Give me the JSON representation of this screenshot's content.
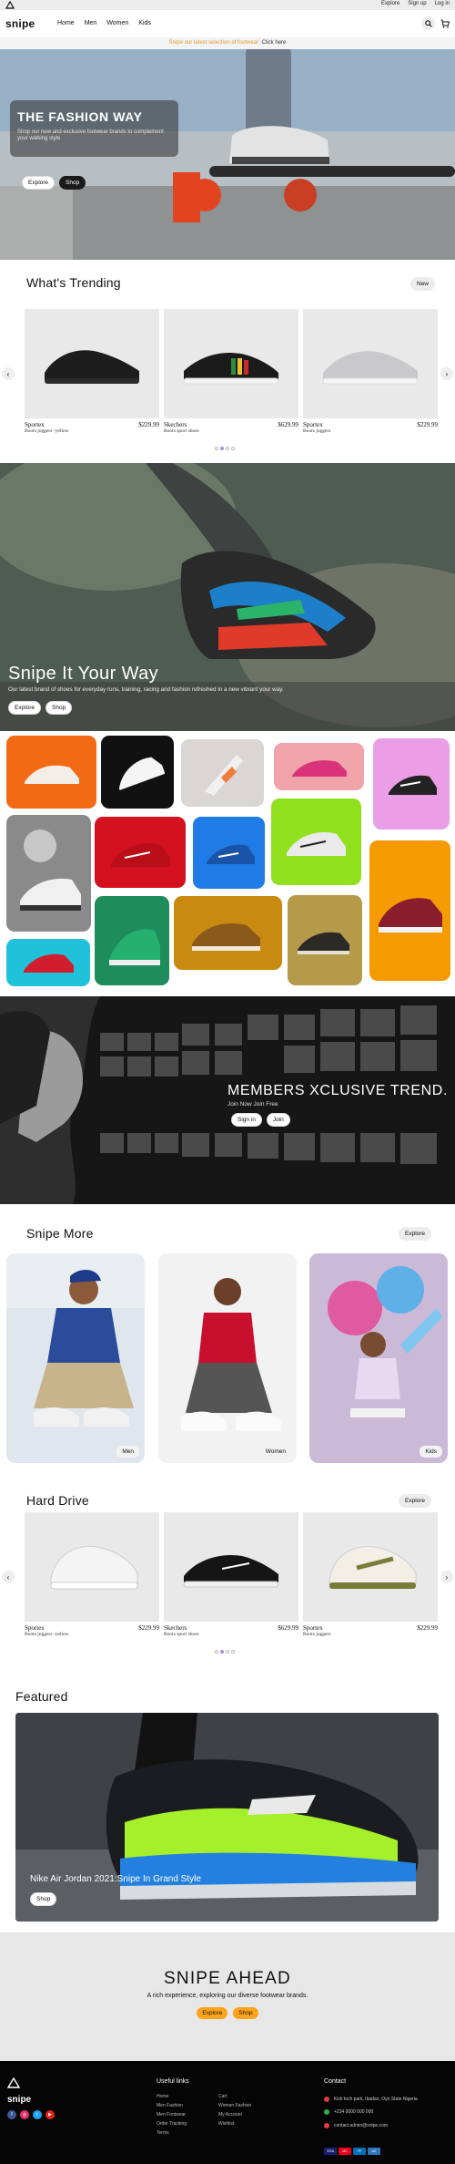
{
  "util": {
    "links": [
      "Explore",
      "Sign up",
      "Log in"
    ]
  },
  "nav": {
    "brand": "snipe",
    "menu": [
      "Home",
      "Men",
      "Women",
      "Kids"
    ]
  },
  "promo": {
    "text": "Snipe our latest selection of footwear",
    "link": "Click here"
  },
  "hero": {
    "title": "THE FASHION WAY",
    "subtitle": "Shop our new and exclusive footwear brands to complement your walking style",
    "buttons": [
      "Explore",
      "Shop"
    ]
  },
  "trending": {
    "title": "What's Trending",
    "pill": "New",
    "products": [
      {
        "name": "Sportex",
        "sub": "Boots joggers -yellow",
        "price": "$229.99"
      },
      {
        "name": "Skechers",
        "sub": "Boots sport shoes",
        "price": "$629.99"
      },
      {
        "name": "Sportex",
        "sub": "Boots joggers",
        "price": "$229.99"
      }
    ]
  },
  "snipe_it": {
    "title": "Snipe It Your Way",
    "subtitle": "Our latest brand of shoes for everyday runs, training, racing and fashion refreshed in a new vibrant your way.",
    "buttons": [
      "Explore",
      "Shop"
    ]
  },
  "members": {
    "title": "MEMBERS XCLUSIVE TREND.",
    "subtitle": "Join Now Join Free",
    "buttons": [
      "Sign in",
      "Join"
    ]
  },
  "snipe_more": {
    "title": "Snipe More",
    "pill": "Explore",
    "categories": [
      "Men",
      "Women",
      "Kids"
    ]
  },
  "hard_drive": {
    "title": "Hard Drive",
    "pill": "Explore",
    "products": [
      {
        "name": "Sportex",
        "sub": "Boots joggers -yellow",
        "price": "$229.99"
      },
      {
        "name": "Skechers",
        "sub": "Boots sport shoes",
        "price": "$629.99"
      },
      {
        "name": "Sportex",
        "sub": "Boots joggers",
        "price": "$229.99"
      }
    ]
  },
  "featured": {
    "title": "Featured",
    "caption": "Nike Air Jordan 2021:Snipe In Grand Style",
    "button": "Shop"
  },
  "ahead": {
    "title": "SNIPE AHEAD",
    "subtitle": "A rich experience, exploring our diverse footwear brands.",
    "buttons": [
      "Explore",
      "Shop"
    ]
  },
  "footer": {
    "brand": "snipe",
    "useful_links_title": "Useful links",
    "links_col1": [
      "Home",
      "Men Fashion",
      "Men Footwear",
      "Order Tracking",
      "Terms"
    ],
    "links_col2": [
      "Cart",
      "Women Fashion",
      "My Account",
      "Wishlist"
    ],
    "contact_title": "Contact",
    "contact": [
      "Kick tech park, Ibadan, Oyo State Nigeria",
      "+234 0000 000 000",
      "contact.admin@snipe.com"
    ],
    "pay_cards": [
      "VISA",
      "MC",
      "PP",
      "AE"
    ]
  },
  "colors": {
    "accent": "#ffa31a",
    "promo": "#e39b2f",
    "dot_active": "#a88bd8"
  }
}
